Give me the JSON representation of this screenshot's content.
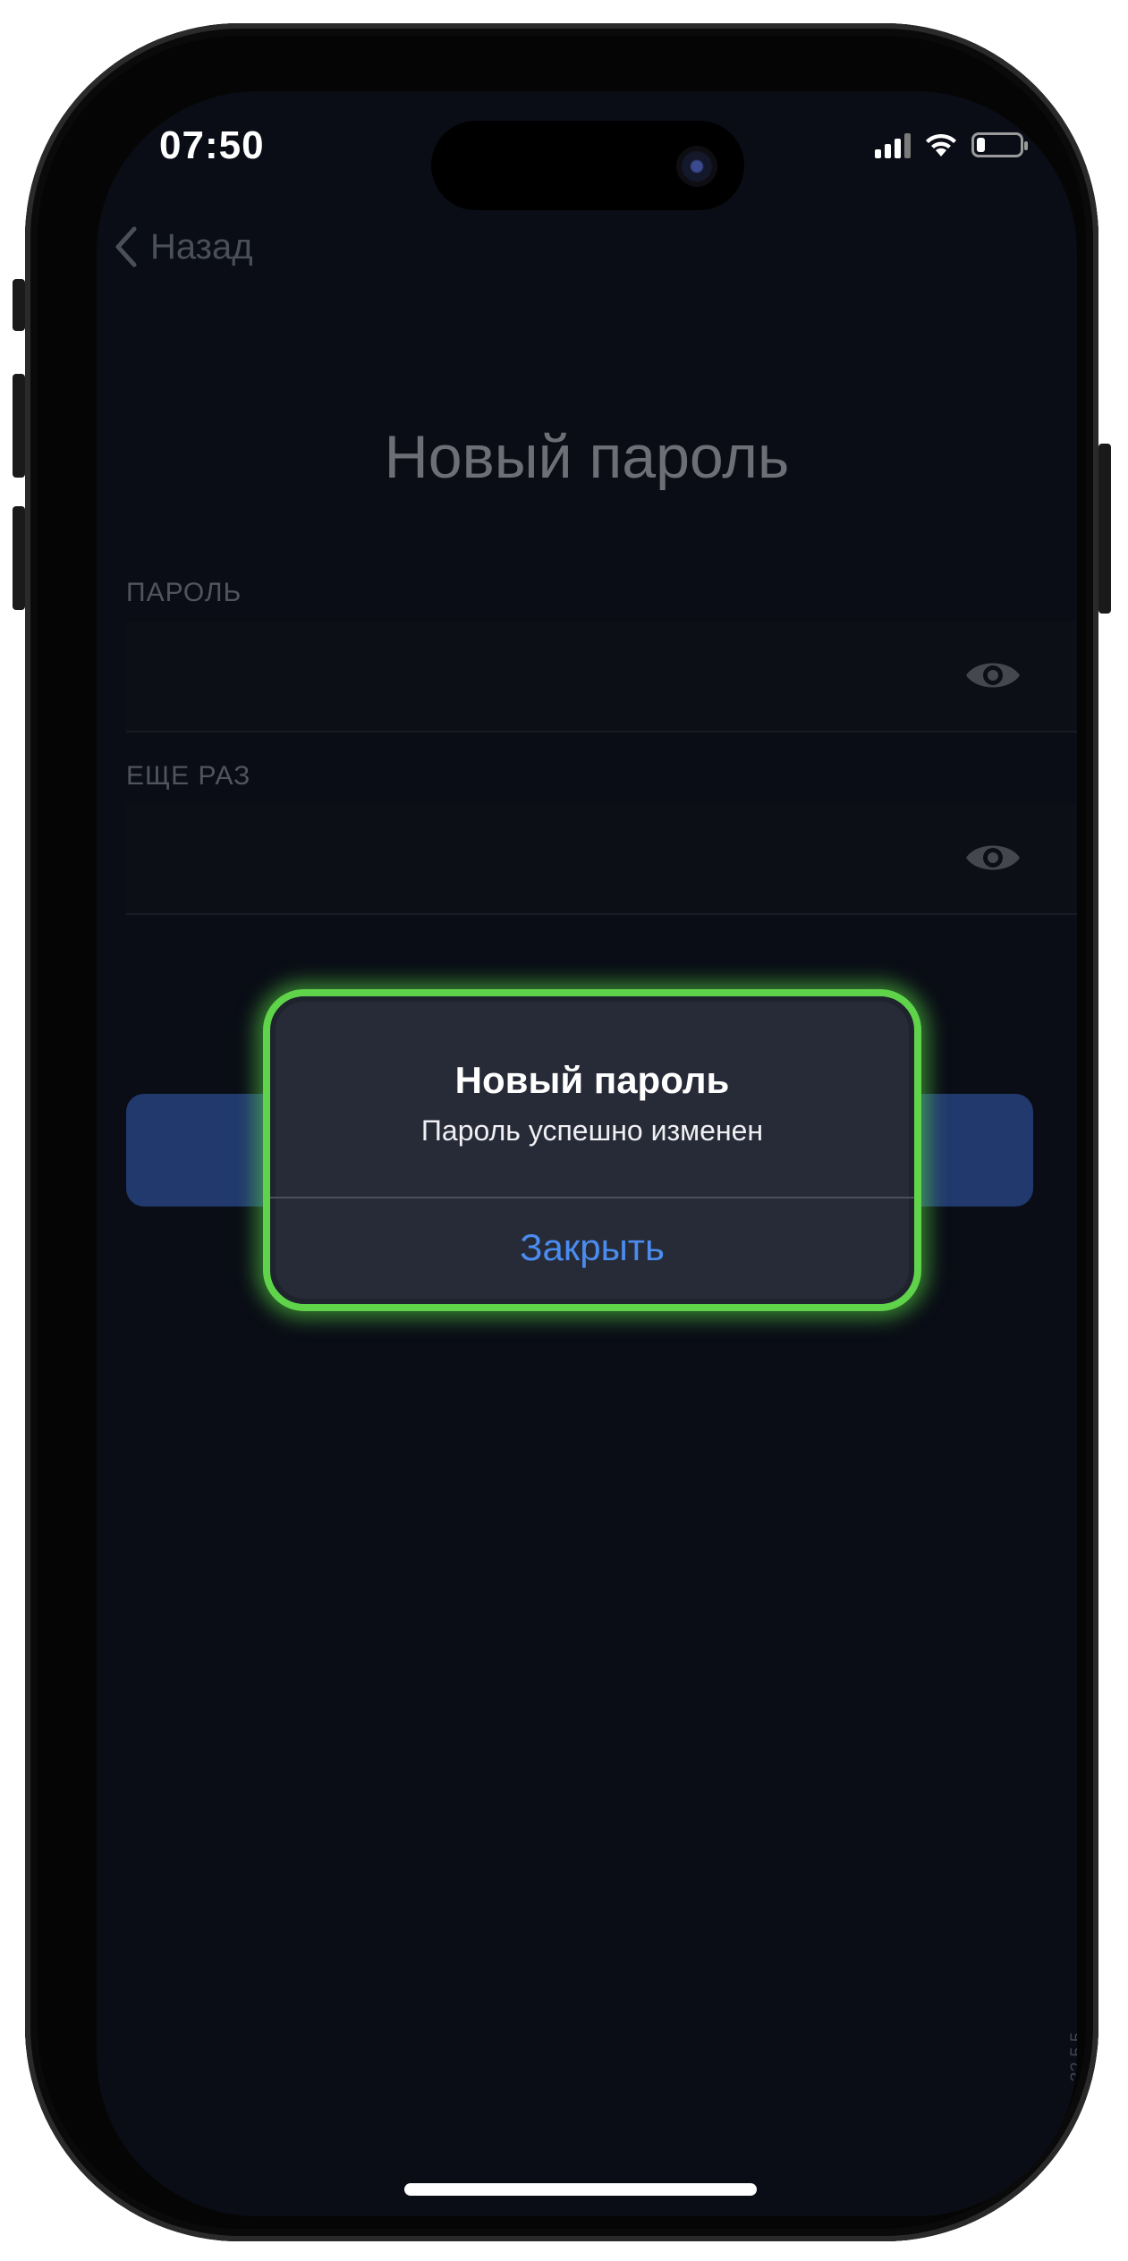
{
  "status_bar": {
    "time": "07:50"
  },
  "nav": {
    "back_label": "Назад"
  },
  "page": {
    "title": "Новый пароль",
    "password_label": "ПАРОЛЬ",
    "password_value": "",
    "repeat_label": "ЕЩЕ РАЗ",
    "repeat_value": ""
  },
  "alert": {
    "title": "Новый пароль",
    "message": "Пароль успешно изменен",
    "close_label": "Закрыть"
  },
  "footer": {
    "version": "32.5.5"
  },
  "colors": {
    "screen_background": "#0a0d16",
    "alert_highlight": "#5fd34a",
    "accent_blue": "#4a8cf0",
    "primary_button": "#3f6fd6"
  },
  "icons": [
    "chevron-left-icon",
    "eye-icon",
    "signal-icon",
    "wifi-icon",
    "battery-icon"
  ],
  "battery_level": 0.2
}
